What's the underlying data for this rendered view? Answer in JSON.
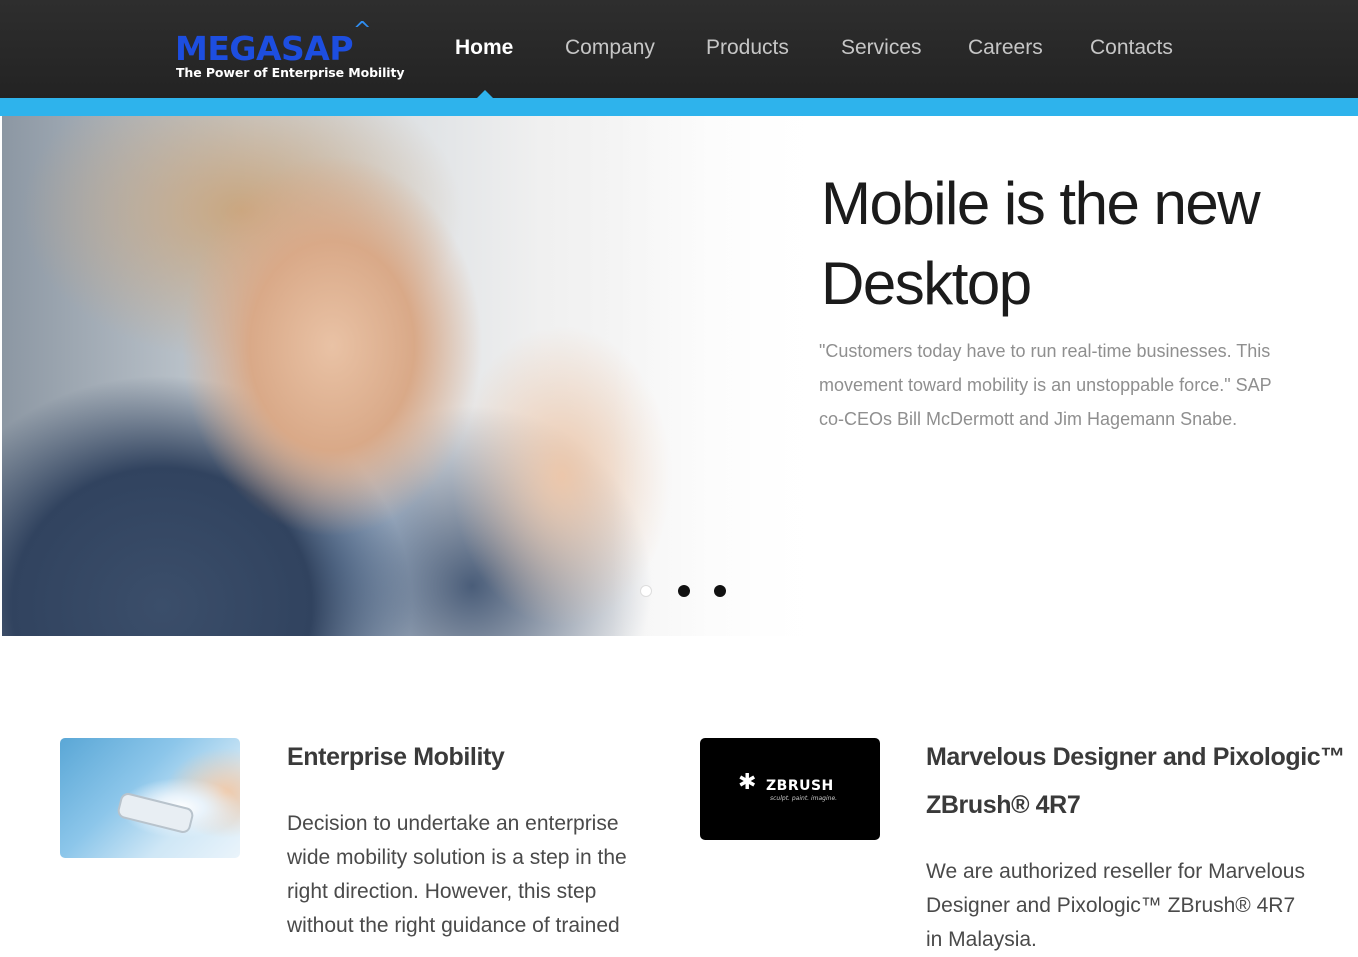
{
  "header": {
    "logo": {
      "name": "MEGASAP",
      "caret": "^",
      "tagline": "The Power of Enterprise Mobility"
    },
    "nav": [
      {
        "label": "Home",
        "active": true
      },
      {
        "label": "Company",
        "active": false
      },
      {
        "label": "Products",
        "active": false
      },
      {
        "label": "Services",
        "active": false
      },
      {
        "label": "Careers",
        "active": false
      },
      {
        "label": "Contacts",
        "active": false
      }
    ],
    "accent_color": "#2eb3ec",
    "brand_color": "#1d4ee0"
  },
  "hero": {
    "title": "Mobile is the new Desktop",
    "quote": "\"Customers today have to run real-time businesses. This movement toward mobility is an unstoppable force.\" SAP co-CEOs Bill McDermott and Jim Hagemann Snabe.",
    "slides": {
      "count": 3,
      "active_index": 0
    }
  },
  "features": [
    {
      "image_icon": "smartphone-in-hand-photo",
      "title": "Enterprise Mobility",
      "text": "Decision to undertake an enterprise wide mobility solution is a step in the right direction. However, this step without the right guidance of trained"
    },
    {
      "image_icon": "zbrush-logo",
      "logo_text": "ZBRUSH",
      "logo_tagline": "sculpt. paint. imagine.",
      "title": "Marvelous Designer and Pixologic™ ZBrush® 4R7",
      "text": "We are authorized reseller for Marvelous Designer and Pixologic™ ZBrush® 4R7 in Malaysia."
    }
  ]
}
